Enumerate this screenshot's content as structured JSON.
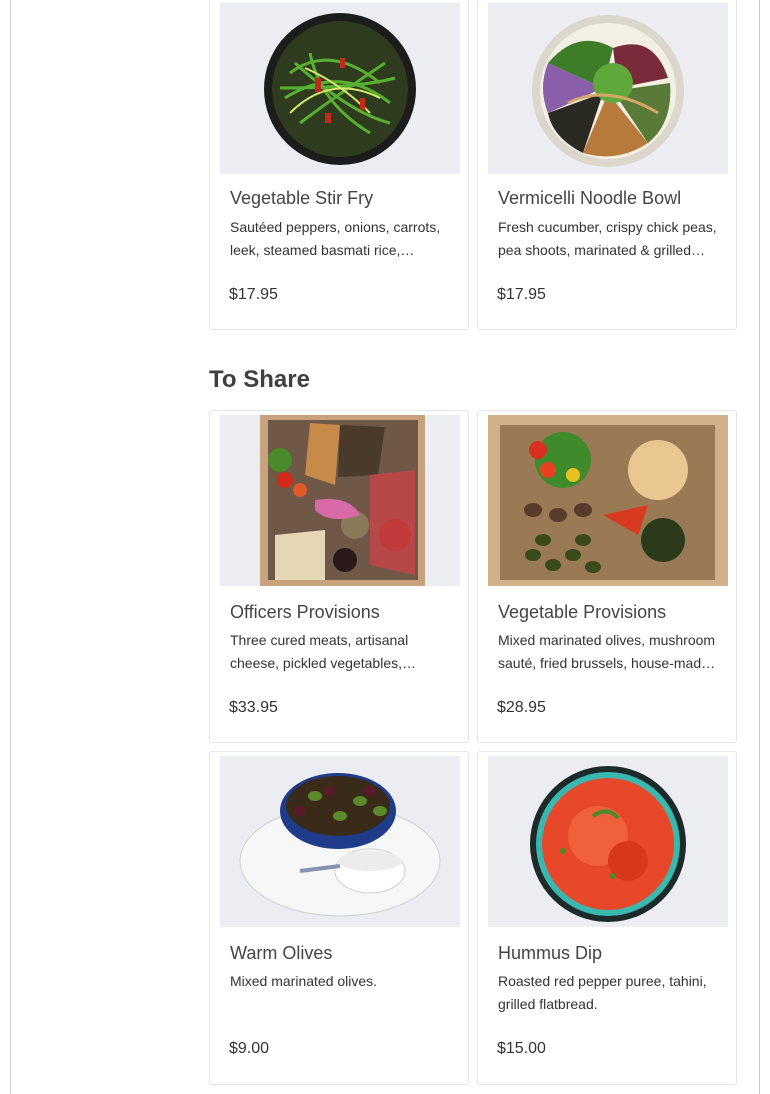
{
  "sections": [
    {
      "items": [
        {
          "name": "Vegetable Stir Fry",
          "description": "Sautéed peppers, onions, carrots, leek, steamed basmati rice, ginger…",
          "price": "$17.95",
          "image_icon": "stir-fry-bowl-image"
        },
        {
          "name": "Vermicelli Noodle Bowl",
          "description": "Fresh cucumber, crispy chick peas, pea shoots, marinated & grilled…",
          "price": "$17.95",
          "image_icon": "noodle-bowl-image"
        }
      ]
    },
    {
      "title": "To Share",
      "items": [
        {
          "name": "Officers Provisions",
          "description": "Three cured meats, artisanal cheese, pickled vegetables,…",
          "price": "$33.95",
          "image_icon": "charcuterie-box-image"
        },
        {
          "name": "Vegetable Provisions",
          "description": "Mixed marinated olives, mushroom sauté, fried brussels, house-mad…",
          "price": "$28.95",
          "image_icon": "vegetable-box-image"
        },
        {
          "name": "Warm Olives",
          "description": "Mixed marinated olives.",
          "price": "$9.00",
          "image_icon": "olives-bowl-image"
        },
        {
          "name": "Hummus Dip",
          "description": "Roasted red pepper puree, tahini, grilled flatbread.",
          "price": "$15.00",
          "image_icon": "hummus-bowl-image"
        }
      ]
    }
  ],
  "colors": {
    "image_background": "#ebebf2",
    "card_border": "#e6e6e6",
    "frame_border": "#c8c8c8"
  }
}
